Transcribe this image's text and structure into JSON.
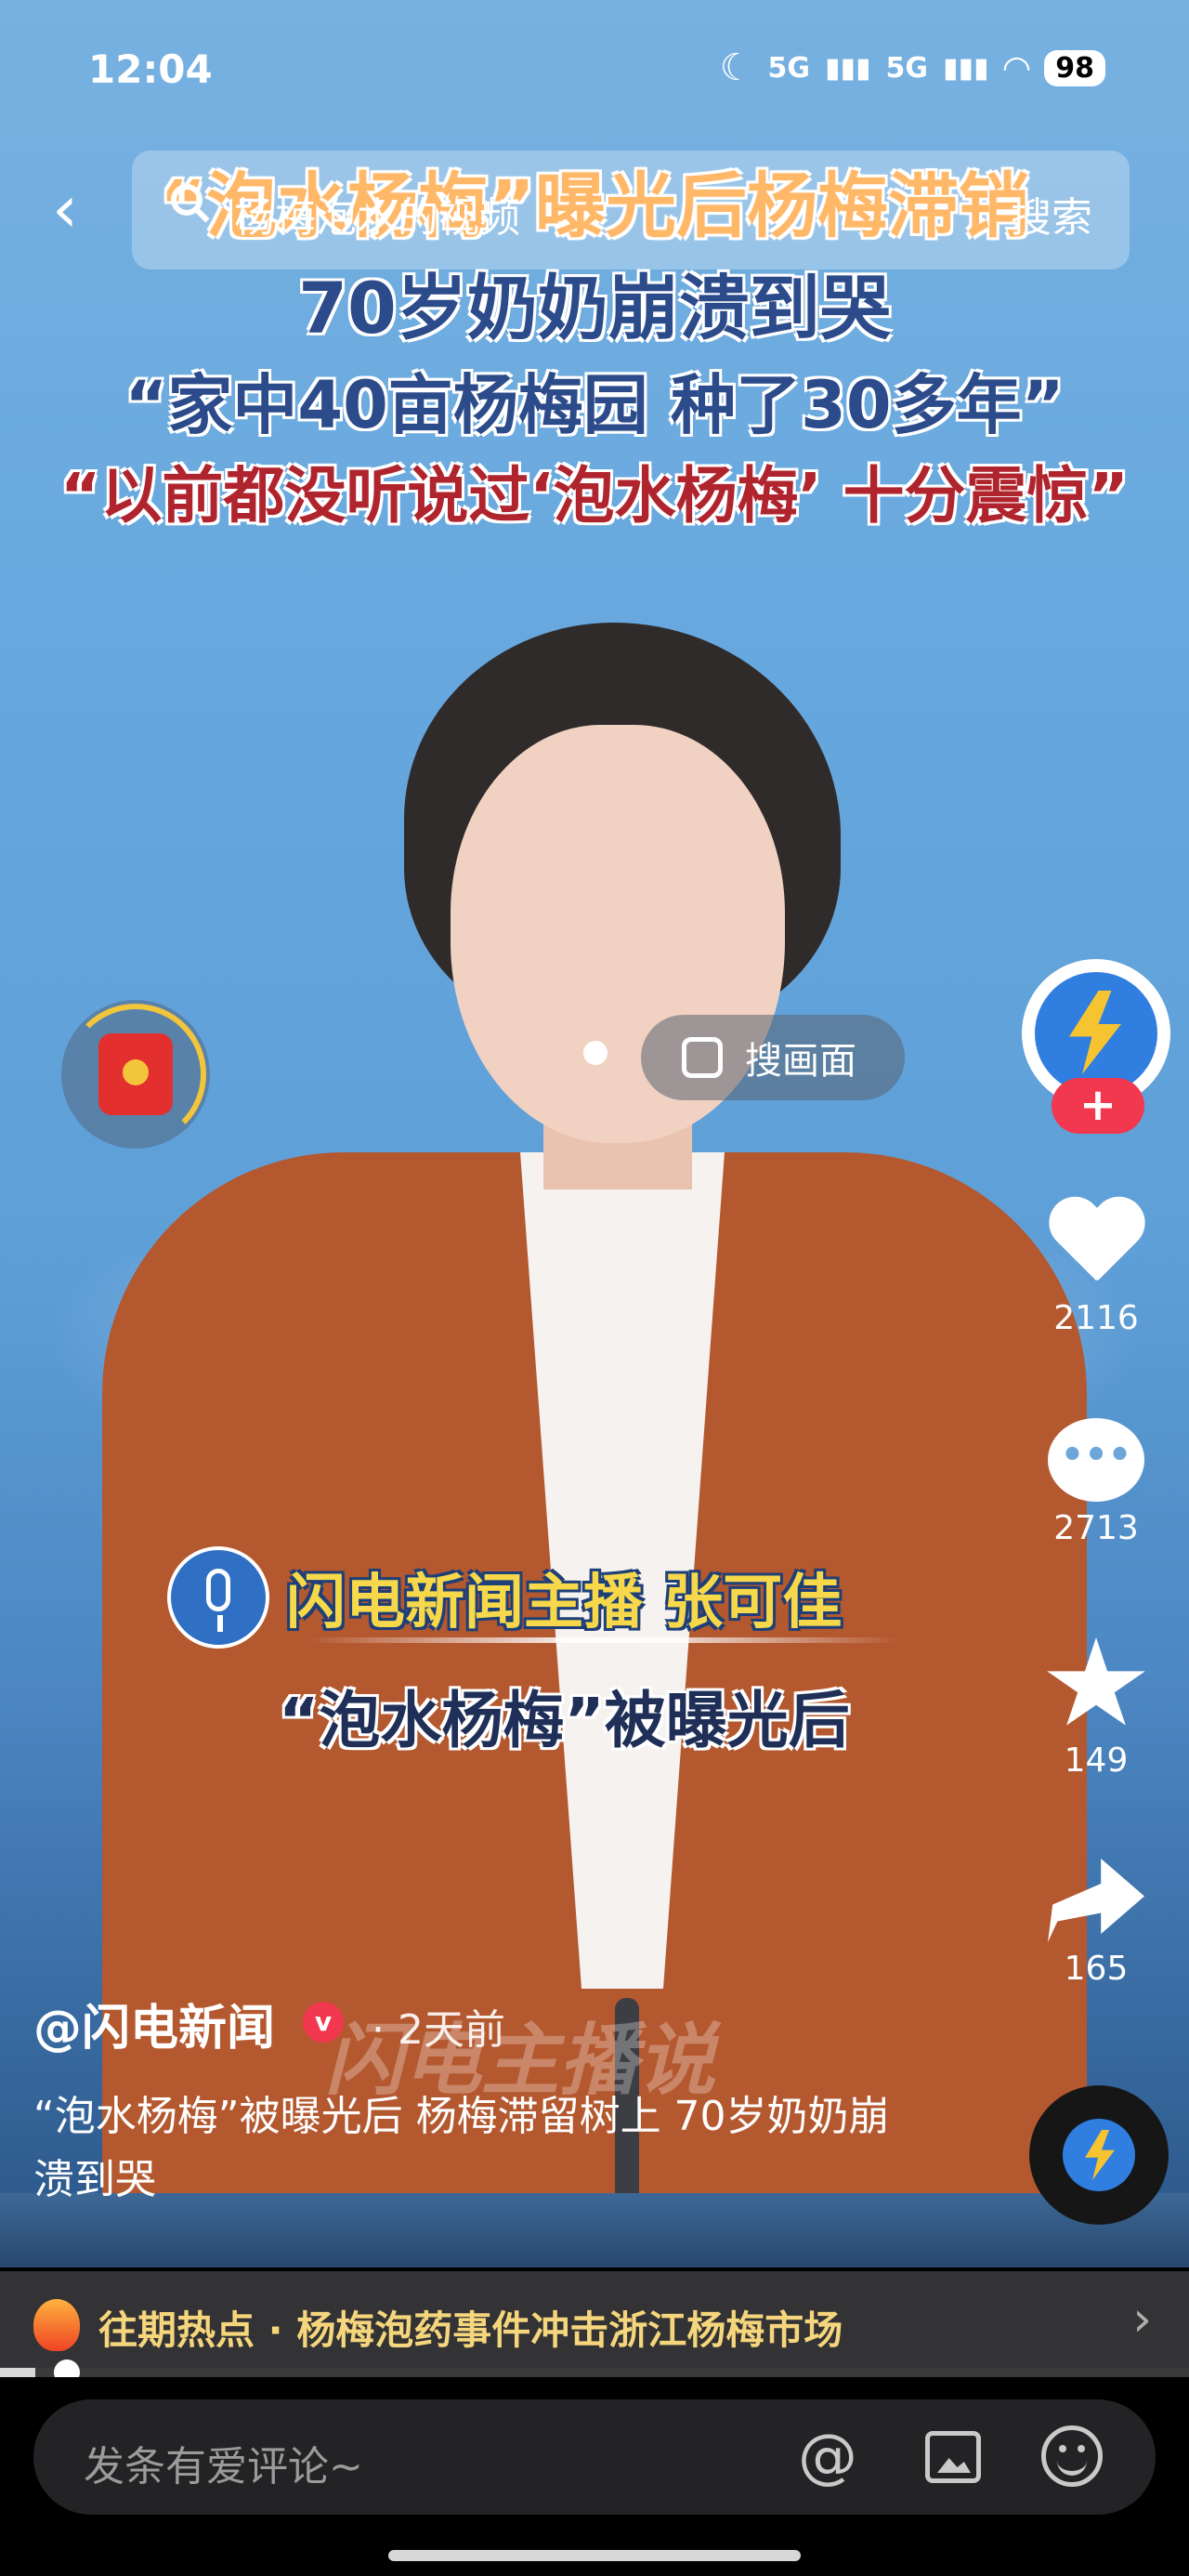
{
  "status_bar": {
    "time": "12:04",
    "signal_1": "5G",
    "signal_2": "5G",
    "battery": "98"
  },
  "top_bar": {
    "search_query": "杨梅泡水的视频",
    "search_button": "搜索"
  },
  "video": {
    "headline_lines": [
      "“泡水杨梅”曝光后杨梅滞销",
      "70岁奶奶崩溃到哭",
      "“家中40亩杨梅园 种了30多年”",
      "“以前都没听说过‘泡水杨梅’ 十分震惊”"
    ],
    "speaker_label": "闪电新闻主播 张可佳",
    "subtitle": "“泡水杨梅”被曝光后",
    "watermark": "闪电主播说",
    "search_frame_label": "搜画面"
  },
  "right_rail": {
    "follow_label": "+",
    "likes": "2116",
    "comments": "2713",
    "favorites": "149",
    "shares": "165"
  },
  "post": {
    "author": "@闪电新闻",
    "verified_badge": "v",
    "time": "· 2天前",
    "caption": "“泡水杨梅”被曝光后 杨梅滞留树上 70岁奶奶崩溃到哭"
  },
  "hot_topic": {
    "text": "往期热点 · 杨梅泡药事件冲击浙江杨梅市场",
    "chevron": "›"
  },
  "playback": {
    "progress": 0.03
  },
  "comment_bar": {
    "placeholder": "发条有爱评论~",
    "at_symbol": "@"
  },
  "icons": [
    "back-chevron-icon",
    "search-icon",
    "red-packet-icon",
    "search-frame-icon",
    "heart-icon",
    "comment-icon",
    "star-icon",
    "share-icon",
    "fire-icon",
    "at-icon",
    "image-icon",
    "emoji-icon"
  ]
}
